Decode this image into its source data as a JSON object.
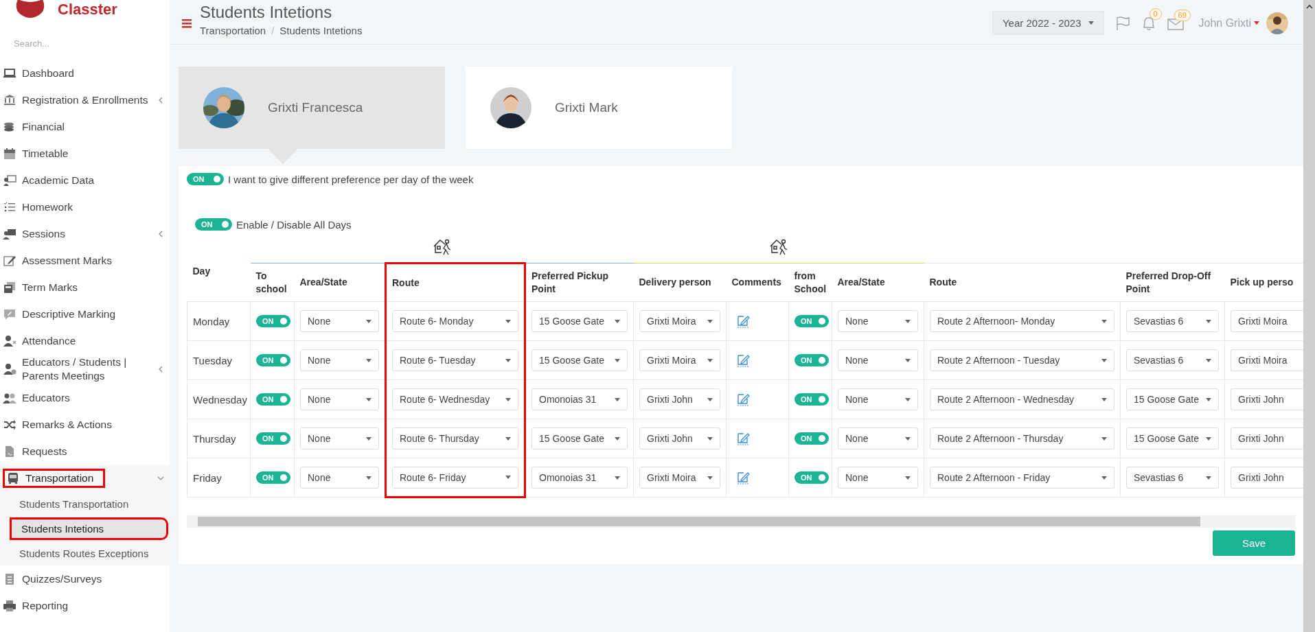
{
  "app": {
    "logo": "Classter"
  },
  "sidebar": {
    "search": {
      "placeholder": "Search..."
    },
    "items": [
      {
        "label": "Dashboard",
        "kind": "link"
      },
      {
        "label": "Registration & Enrollments",
        "kind": "group",
        "expanded": false
      },
      {
        "label": "Financial",
        "kind": "link"
      },
      {
        "label": "Timetable",
        "kind": "link"
      },
      {
        "label": "Academic Data",
        "kind": "link"
      },
      {
        "label": "Homework",
        "kind": "link"
      },
      {
        "label": "Sessions",
        "kind": "group",
        "expanded": false
      },
      {
        "label": "Assessment Marks",
        "kind": "link"
      },
      {
        "label": "Term Marks",
        "kind": "link"
      },
      {
        "label": "Descriptive Marking",
        "kind": "link"
      },
      {
        "label": "Attendance",
        "kind": "link"
      },
      {
        "label": "Educators / Students | Parents Meetings",
        "kind": "group",
        "expanded": false
      },
      {
        "label": "Educators",
        "kind": "link"
      },
      {
        "label": "Remarks & Actions",
        "kind": "link"
      },
      {
        "label": "Requests",
        "kind": "link"
      },
      {
        "label": "Transportation",
        "kind": "group",
        "expanded": true,
        "highlighted": true,
        "children": [
          {
            "label": "Students Transportation",
            "selected": false,
            "highlighted": false
          },
          {
            "label": "Students Intetions",
            "selected": true,
            "highlighted": true
          },
          {
            "label": "Students Routes Exceptions",
            "selected": false,
            "highlighted": false
          }
        ]
      },
      {
        "label": "Quizzes/Surveys",
        "kind": "link"
      },
      {
        "label": "Reporting",
        "kind": "link"
      }
    ]
  },
  "header": {
    "title": "Students Intetions",
    "breadcrumbs": [
      "Transportation",
      "Students Intetions"
    ],
    "separator": "/",
    "year": "Year 2022 - 2023",
    "notifications": "0",
    "messages": "69",
    "user": "John Grixti"
  },
  "students": [
    {
      "name": "Grixti Francesca",
      "selected": true
    },
    {
      "name": "Grixti Mark",
      "selected": false
    }
  ],
  "different_preference": {
    "on": true,
    "switch_text": "ON",
    "label": "I want to give different preference per day of the week"
  },
  "enable_all": {
    "on": true,
    "switch_text": "ON",
    "label": "Enable / Disable All Days"
  },
  "table": {
    "columns": [
      {
        "label": "Day",
        "highlighted": false
      },
      {
        "label": "To school",
        "highlighted": false
      },
      {
        "label": "Area/State",
        "highlighted": false
      },
      {
        "label": "Route",
        "highlighted": true
      },
      {
        "label": "Preferred Pickup Point",
        "highlighted": false
      },
      {
        "label": "Delivery person",
        "highlighted": false
      },
      {
        "label": "Comments",
        "highlighted": false
      },
      {
        "label": "from School",
        "highlighted": false
      },
      {
        "label": "Area/State",
        "highlighted": false
      },
      {
        "label": "Route",
        "highlighted": false
      },
      {
        "label": "Preferred Drop-Off Point",
        "highlighted": false
      },
      {
        "label": "Pick up perso",
        "highlighted": false
      }
    ],
    "rows": [
      {
        "day": "Monday",
        "to_school": {
          "on": true,
          "text": "ON"
        },
        "area": "None",
        "route": "Route 6- Monday",
        "pickup_point": "15 Goose Gate",
        "delivery_person": "Grixti Moira",
        "from_school": {
          "on": true,
          "text": "ON"
        },
        "area_back": "None",
        "route_back": "Route 2 Afternoon- Monday",
        "dropoff_point": "Sevastias 6",
        "pickup_person": "Grixti Moira"
      },
      {
        "day": "Tuesday",
        "to_school": {
          "on": true,
          "text": "ON"
        },
        "area": "None",
        "route": "Route 6- Tuesday",
        "pickup_point": "15 Goose Gate",
        "delivery_person": "Grixti Moira",
        "from_school": {
          "on": true,
          "text": "ON"
        },
        "area_back": "None",
        "route_back": "Route 2 Afternoon - Tuesday",
        "dropoff_point": "Sevastias 6",
        "pickup_person": "Grixti Moira"
      },
      {
        "day": "Wednesday",
        "to_school": {
          "on": true,
          "text": "ON"
        },
        "area": "None",
        "route": "Route 6- Wednesday",
        "pickup_point": "Omonoias 31",
        "delivery_person": "Grixti John",
        "from_school": {
          "on": true,
          "text": "ON"
        },
        "area_back": "None",
        "route_back": "Route 2 Afternoon - Wednesday",
        "dropoff_point": "15 Goose Gate",
        "pickup_person": "Grixti John"
      },
      {
        "day": "Thursday",
        "to_school": {
          "on": true,
          "text": "ON"
        },
        "area": "None",
        "route": "Route 6- Thursday",
        "pickup_point": "15 Goose Gate",
        "delivery_person": "Grixti John",
        "from_school": {
          "on": true,
          "text": "ON"
        },
        "area_back": "None",
        "route_back": "Route 2 Afternoon - Thursday",
        "dropoff_point": "15 Goose Gate",
        "pickup_person": "Grixti John"
      },
      {
        "day": "Friday",
        "to_school": {
          "on": true,
          "text": "ON"
        },
        "area": "None",
        "route": "Route 6- Friday",
        "pickup_point": "Omonoias 31",
        "delivery_person": "Grixti Moira",
        "from_school": {
          "on": true,
          "text": "ON"
        },
        "area_back": "None",
        "route_back": "Route 2 Afternoon - Friday",
        "dropoff_point": "Sevastias 6",
        "pickup_person": "Grixti John"
      }
    ]
  },
  "save_button": "Save"
}
